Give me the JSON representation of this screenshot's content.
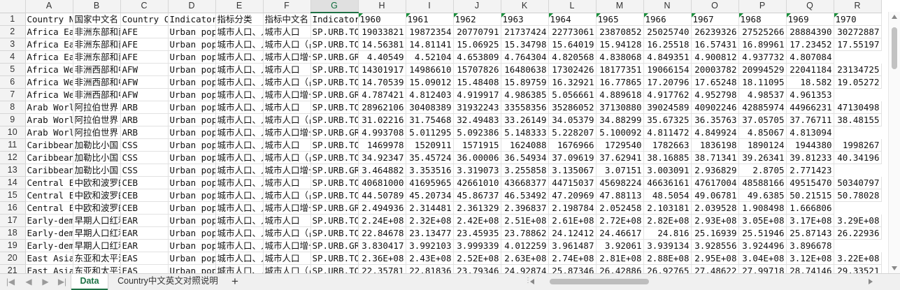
{
  "columns": [
    "A",
    "B",
    "C",
    "D",
    "E",
    "F",
    "G",
    "H",
    "I",
    "J",
    "K",
    "L",
    "M",
    "N",
    "O",
    "P",
    "Q",
    "R"
  ],
  "selected_column": "G",
  "rows": [
    [
      "Country Name",
      "国家中文名",
      "Country Code",
      "Indicator Name",
      "指标分类",
      "指标中文名",
      "Indicator Code",
      "1960",
      "1961",
      "1962",
      "1963",
      "1964",
      "1965",
      "1966",
      "1967",
      "1968",
      "1969",
      "1970"
    ],
    [
      "Africa Eastern and Southern",
      "非洲东部和南部",
      "AFE",
      "Urban population",
      "城市人口、人口总数",
      "城市人口",
      "SP.URB.TOTL",
      "19033821",
      "19872354",
      "20770791",
      "21737424",
      "22773061",
      "23870852",
      "25025740",
      "26239326",
      "27525266",
      "28884390",
      "30272887"
    ],
    [
      "Africa Eastern and Southern",
      "非洲东部和南部",
      "AFE",
      "Urban population (% of total population)",
      "城市人口、人口总数",
      "城市人口（占总人口的比例）",
      "SP.URB.TOTL.IN.ZS",
      "14.56381",
      "14.81141",
      "15.06925",
      "15.34798",
      "15.64019",
      "15.94128",
      "16.25518",
      "16.57431",
      "16.89961",
      "17.23452",
      "17.55197"
    ],
    [
      "Africa Eastern and Southern",
      "非洲东部和南部",
      "AFE",
      "Urban population growth (annual %)",
      "城市人口、人口总数",
      "城市人口增长（年度百分比）",
      "SP.URB.GROW",
      "4.40549",
      "4.52104",
      "4.653809",
      "4.764304",
      "4.820568",
      "4.838068",
      "4.849351",
      "4.900812",
      "4.937732",
      "4.807084"
    ],
    [
      "Africa Western and Central",
      "非洲西部和中部",
      "AFW",
      "Urban population",
      "城市人口、人口总数",
      "城市人口",
      "SP.URB.TOTL",
      "14301917",
      "14986610",
      "15707826",
      "16480638",
      "17302426",
      "18177351",
      "19066154",
      "20003782",
      "20994529",
      "22041184",
      "23134725"
    ],
    [
      "Africa Western and Central",
      "非洲西部和中部",
      "AFW",
      "Urban population (% of total population)",
      "城市人口、人口总数",
      "城市人口（占总人口的比例）",
      "SP.URB.TOTL.IN.ZS",
      "14.70539",
      "15.09012",
      "15.48408",
      "15.89759",
      "16.32921",
      "16.77865",
      "17.20796",
      "17.65248",
      "18.11095",
      "18.582",
      "19.05272"
    ],
    [
      "Africa Western and Central",
      "非洲西部和中部",
      "AFW",
      "Urban population growth (annual %)",
      "城市人口、人口总数",
      "城市人口增长（年度百分比）",
      "SP.URB.GROW",
      "4.787421",
      "4.812403",
      "4.919917",
      "4.986385",
      "5.056661",
      "4.889618",
      "4.917762",
      "4.952798",
      "4.98537",
      "4.961353"
    ],
    [
      "Arab World",
      "阿拉伯世界",
      "ARB",
      "Urban population",
      "城市人口、人口总数",
      "城市人口",
      "SP.URB.TOTL",
      "28962106",
      "30408389",
      "31932243",
      "33558356",
      "35286052",
      "37130880",
      "39024589",
      "40902246",
      "42885974",
      "44966231",
      "47130498"
    ],
    [
      "Arab World",
      "阿拉伯世界",
      "ARB",
      "Urban population (% of total population)",
      "城市人口、人口总数",
      "城市人口（占总人口的比例）",
      "SP.URB.TOTL.IN.ZS",
      "31.02216",
      "31.75468",
      "32.49483",
      "33.26149",
      "34.05379",
      "34.88299",
      "35.67325",
      "36.35763",
      "37.05705",
      "37.76711",
      "38.48155"
    ],
    [
      "Arab World",
      "阿拉伯世界",
      "ARB",
      "Urban population growth (annual %)",
      "城市人口、人口总数",
      "城市人口增长（年度百分比）",
      "SP.URB.GROW",
      "4.993708",
      "5.011295",
      "5.092386",
      "5.148333",
      "5.228207",
      "5.100092",
      "4.811472",
      "4.849924",
      "4.85067",
      "4.813094"
    ],
    [
      "Caribbean small states",
      "加勒比小国",
      "CSS",
      "Urban population",
      "城市人口、人口总数",
      "城市人口",
      "SP.URB.TOTL",
      "1469978",
      "1520911",
      "1571915",
      "1624088",
      "1676966",
      "1729540",
      "1782663",
      "1836198",
      "1890124",
      "1944380",
      "1998267"
    ],
    [
      "Caribbean small states",
      "加勒比小国",
      "CSS",
      "Urban population (% of total population)",
      "城市人口、人口总数",
      "城市人口（占总人口的比例）",
      "SP.URB.TOTL.IN.ZS",
      "34.92347",
      "35.45724",
      "36.00006",
      "36.54934",
      "37.09619",
      "37.62941",
      "38.16885",
      "38.71341",
      "39.26341",
      "39.81233",
      "40.34196"
    ],
    [
      "Caribbean small states",
      "加勒比小国",
      "CSS",
      "Urban population growth (annual %)",
      "城市人口、人口总数",
      "城市人口增长（年度百分比）",
      "SP.URB.GROW",
      "3.464882",
      "3.353516",
      "3.319073",
      "3.255858",
      "3.135067",
      "3.07151",
      "3.003091",
      "2.936829",
      "2.8705",
      "2.771423"
    ],
    [
      "Central Europe and the Baltics",
      "中欧和波罗的海",
      "CEB",
      "Urban population",
      "城市人口、人口总数",
      "城市人口",
      "SP.URB.TOTL",
      "40681000",
      "41695965",
      "42661010",
      "43668377",
      "44715037",
      "45698224",
      "46636161",
      "47617004",
      "48588166",
      "49515470",
      "50340797"
    ],
    [
      "Central Europe and the Baltics",
      "中欧和波罗的海",
      "CEB",
      "Urban population (% of total population)",
      "城市人口、人口总数",
      "城市人口（占总人口的比例）",
      "SP.URB.TOTL.IN.ZS",
      "44.50789",
      "45.20734",
      "45.86737",
      "46.53492",
      "47.20969",
      "47.88113",
      "48.5054",
      "49.06781",
      "49.6385",
      "50.21515",
      "50.78028"
    ],
    [
      "Central Europe and the Baltics",
      "中欧和波罗的海",
      "CEB",
      "Urban population growth (annual %)",
      "城市人口、人口总数",
      "城市人口增长（年度百分比）",
      "SP.URB.GROW",
      "2.494936",
      "2.314481",
      "2.361329",
      "2.396837",
      "2.198784",
      "2.052458",
      "2.103181",
      "2.039528",
      "1.908498",
      "1.666806"
    ],
    [
      "Early-demographic dividend",
      "早期人口红利",
      "EAR",
      "Urban population",
      "城市人口、人口总数",
      "城市人口",
      "SP.URB.TOTL",
      "2.24E+08",
      "2.32E+08",
      "2.42E+08",
      "2.51E+08",
      "2.61E+08",
      "2.72E+08",
      "2.82E+08",
      "2.93E+08",
      "3.05E+08",
      "3.17E+08",
      "3.29E+08"
    ],
    [
      "Early-demographic dividend",
      "早期人口红利",
      "EAR",
      "Urban population (% of total population)",
      "城市人口、人口总数",
      "城市人口（占总人口的比例）",
      "SP.URB.TOTL.IN.ZS",
      "22.84678",
      "23.13477",
      "23.45935",
      "23.78862",
      "24.12412",
      "24.46617",
      "24.816",
      "25.16939",
      "25.51946",
      "25.87143",
      "26.22936"
    ],
    [
      "Early-demographic dividend",
      "早期人口红利",
      "EAR",
      "Urban population growth (annual %)",
      "城市人口、人口总数",
      "城市人口增长（年度百分比）",
      "SP.URB.GROW",
      "3.830417",
      "3.992103",
      "3.999339",
      "4.012259",
      "3.961487",
      "3.92061",
      "3.939134",
      "3.928556",
      "3.924496",
      "3.896678"
    ],
    [
      "East Asia & Pacific",
      "东亚和太平洋",
      "EAS",
      "Urban population",
      "城市人口、人口总数",
      "城市人口",
      "SP.URB.TOTL",
      "2.36E+08",
      "2.43E+08",
      "2.52E+08",
      "2.63E+08",
      "2.74E+08",
      "2.81E+08",
      "2.88E+08",
      "2.95E+08",
      "3.04E+08",
      "3.12E+08",
      "3.22E+08"
    ],
    [
      "East Asia & Pacific",
      "东亚和太平洋",
      "EAS",
      "Urban population (% of total population)",
      "城市人口、人口总数",
      "城市人口（占总人口的比例）",
      "SP.URB.TOTL.IN.ZS",
      "22.35781",
      "22.81836",
      "23.79346",
      "24.92874",
      "25.87346",
      "26.42886",
      "26.92765",
      "27.48622",
      "27.99718",
      "28.74146",
      "29.33521"
    ]
  ],
  "sheet_tabs": [
    "Data",
    "Country中文英文对照说明"
  ],
  "active_tab": "Data"
}
